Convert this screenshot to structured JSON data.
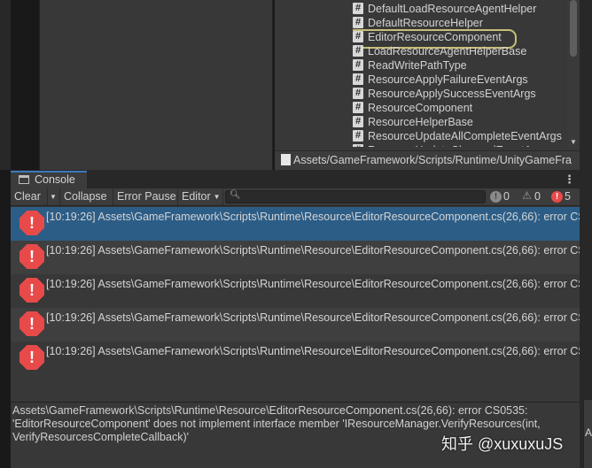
{
  "project": {
    "files": [
      {
        "label": "DefaultLoadResourceAgentHelper",
        "selected": false
      },
      {
        "label": "DefaultResourceHelper",
        "selected": false
      },
      {
        "label": "EditorResourceComponent",
        "selected": true
      },
      {
        "label": "LoadResourceAgentHelperBase",
        "selected": false
      },
      {
        "label": "ReadWritePathType",
        "selected": false
      },
      {
        "label": "ResourceApplyFailureEventArgs",
        "selected": false
      },
      {
        "label": "ResourceApplySuccessEventArgs",
        "selected": false
      },
      {
        "label": "ResourceComponent",
        "selected": false
      },
      {
        "label": "ResourceHelperBase",
        "selected": false
      },
      {
        "label": "ResourceUpdateAllCompleteEventArgs",
        "selected": false
      },
      {
        "label": "ResourceUpdateChangedEventArgs",
        "selected": false
      }
    ],
    "file_icon": "csharp-script-icon",
    "path": "Assets/GameFramework/Scripts/Runtime/UnityGameFra"
  },
  "console": {
    "tab_label": "Console",
    "toolbar": {
      "clear_label": "Clear",
      "collapse_label": "Collapse",
      "error_pause_label": "Error Pause",
      "editor_label": "Editor",
      "search_placeholder": "",
      "info_count": "0",
      "warning_count": "0",
      "error_count": "5"
    },
    "entries": [
      {
        "text": "[10:19:26] Assets\\GameFramework\\Scripts\\Runtime\\Resource\\EditorResourceComponent.cs(26,66): error CS",
        "selected": true
      },
      {
        "text": "[10:19:26] Assets\\GameFramework\\Scripts\\Runtime\\Resource\\EditorResourceComponent.cs(26,66): error CS",
        "selected": false
      },
      {
        "text": "[10:19:26] Assets\\GameFramework\\Scripts\\Runtime\\Resource\\EditorResourceComponent.cs(26,66): error CS",
        "selected": false
      },
      {
        "text": "[10:19:26] Assets\\GameFramework\\Scripts\\Runtime\\Resource\\EditorResourceComponent.cs(26,66): error CS",
        "selected": false
      },
      {
        "text": "[10:19:26] Assets\\GameFramework\\Scripts\\Runtime\\Resource\\EditorResourceComponent.cs(26,66): error CS",
        "selected": false
      }
    ],
    "detail": {
      "line1": "Assets\\GameFramework\\Scripts\\Runtime\\Resource\\EditorResourceComponent.cs(26,66): error CS0535:",
      "line2": "'EditorResourceComponent' does not implement interface member 'IResourceManager.VerifyResources(int,",
      "line3": "VerifyResourcesCompleteCallback)'"
    }
  },
  "side_panel_letter": "A",
  "watermark": "知乎 @xuxuxuJS",
  "colors": {
    "selection": "#2c5d87",
    "tab_accent": "#3a79bb",
    "error_red": "#e84a4a",
    "highlight_ring": "#c8be78"
  }
}
